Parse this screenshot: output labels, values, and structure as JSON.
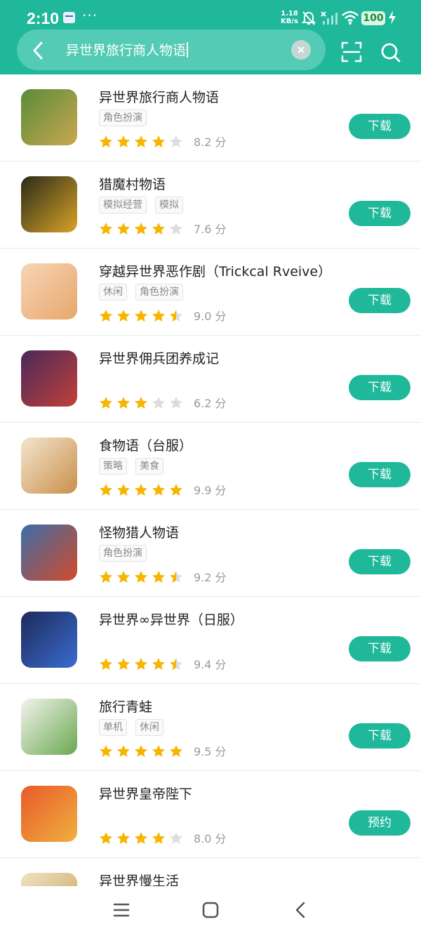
{
  "status_bar": {
    "time": "2:10",
    "dots": "···",
    "speed_value": "1.18",
    "speed_unit": "KB/s",
    "battery": "100"
  },
  "search": {
    "query": "异世界旅行商人物语"
  },
  "results": [
    {
      "name": "异世界旅行商人物语",
      "tags": [
        "角色扮演"
      ],
      "rating": 4,
      "score": "8.2 分",
      "action": "下载",
      "icon_colors": [
        "#5a8b3a",
        "#c9a84f"
      ]
    },
    {
      "name": "猎魔村物语",
      "tags": [
        "模拟经营",
        "模拟"
      ],
      "rating": 4,
      "score": "7.6 分",
      "action": "下载",
      "icon_colors": [
        "#2a2a1a",
        "#d9a326"
      ]
    },
    {
      "name": "穿越异世界恶作剧（Trickcal Rveive）",
      "tags": [
        "休闲",
        "角色扮演"
      ],
      "rating": 4.5,
      "score": "9.0 分",
      "action": "下载",
      "icon_colors": [
        "#f6d6b8",
        "#e8a66a"
      ]
    },
    {
      "name": "异世界佣兵团养成记",
      "tags": [],
      "rating": 3,
      "score": "6.2 分",
      "action": "下载",
      "icon_colors": [
        "#4a2a5a",
        "#c2403a"
      ]
    },
    {
      "name": "食物语（台服）",
      "tags": [
        "策略",
        "美食"
      ],
      "rating": 5,
      "score": "9.9 分",
      "action": "下载",
      "icon_colors": [
        "#f4e6cf",
        "#c98f4a"
      ]
    },
    {
      "name": "怪物猎人物语",
      "tags": [
        "角色扮演"
      ],
      "rating": 4.5,
      "score": "9.2 分",
      "action": "下载",
      "icon_colors": [
        "#3b6ea8",
        "#d24a2a"
      ]
    },
    {
      "name": "异世界∞异世界（日服）",
      "tags": [],
      "rating": 4.5,
      "score": "9.4 分",
      "action": "下载",
      "icon_colors": [
        "#1d2a5a",
        "#3a6cd0"
      ]
    },
    {
      "name": "旅行青蛙",
      "tags": [
        "单机",
        "休闲"
      ],
      "rating": 5,
      "score": "9.5 分",
      "action": "下载",
      "icon_colors": [
        "#f3f3ee",
        "#6aa84f"
      ]
    },
    {
      "name": "异世界皇帝陛下",
      "tags": [],
      "rating": 4,
      "score": "8.0 分",
      "action": "预约",
      "icon_colors": [
        "#e85a2a",
        "#f0b040"
      ]
    },
    {
      "name": "异世界慢生活",
      "tags": [],
      "rating": 0,
      "score": "",
      "action": "",
      "icon_colors": [
        "#efe3c4",
        "#c9a25a"
      ]
    }
  ],
  "colors": {
    "accent": "#1fb89a",
    "star_on": "#f7b500",
    "star_off": "#dddddd"
  },
  "icons": {
    "back": "chevron-left-icon",
    "clear": "clear-icon",
    "scan": "scan-icon",
    "search": "search-icon"
  }
}
